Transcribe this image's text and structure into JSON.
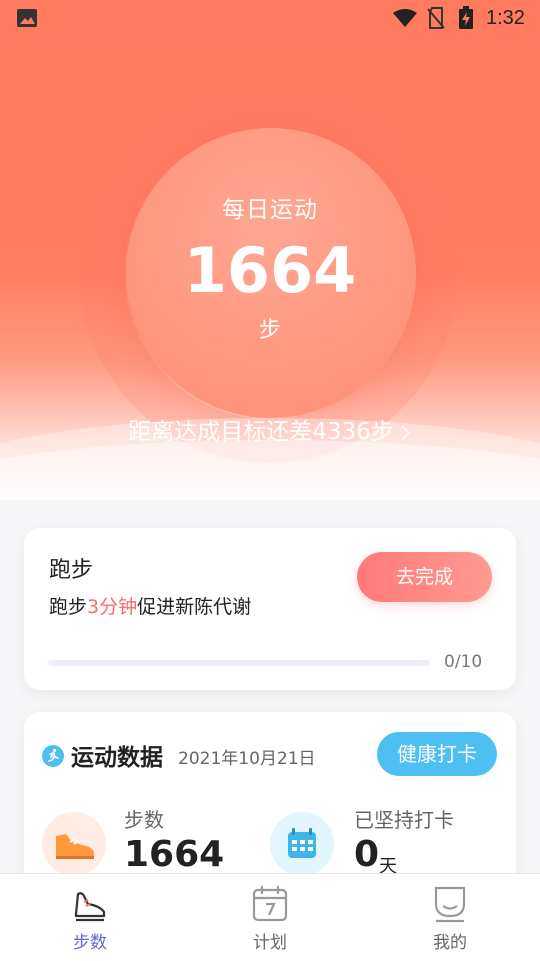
{
  "status_bar": {
    "time": "1:32"
  },
  "hero": {
    "daily_label": "每日运动",
    "steps": "1664",
    "unit": "步",
    "goal_text": "距离达成目标还差4336步"
  },
  "run_task": {
    "title": "跑步",
    "desc_prefix": "跑步",
    "desc_highlight": "3分钟",
    "desc_suffix": "促进新陈代谢",
    "button_label": "去完成",
    "progress_text": "0/10",
    "progress_fraction": 0
  },
  "sport_data": {
    "title": "运动数据",
    "date": "2021年10月21日",
    "checkin_label": "健康打卡",
    "steps_label": "步数",
    "steps_value": "1664",
    "streak_label": "已坚持打卡",
    "streak_value": "0",
    "streak_unit": "天"
  },
  "tabs": [
    {
      "label": "步数",
      "icon": "shoe-icon",
      "active": true
    },
    {
      "label": "计划",
      "icon": "calendar-icon",
      "active": false
    },
    {
      "label": "我的",
      "icon": "profile-icon",
      "active": false
    }
  ],
  "colors": {
    "hero": "#ff7a5e",
    "accent_red": "#ff6b63",
    "accent_blue": "#4dbff0",
    "tab_active": "#6367d8"
  }
}
